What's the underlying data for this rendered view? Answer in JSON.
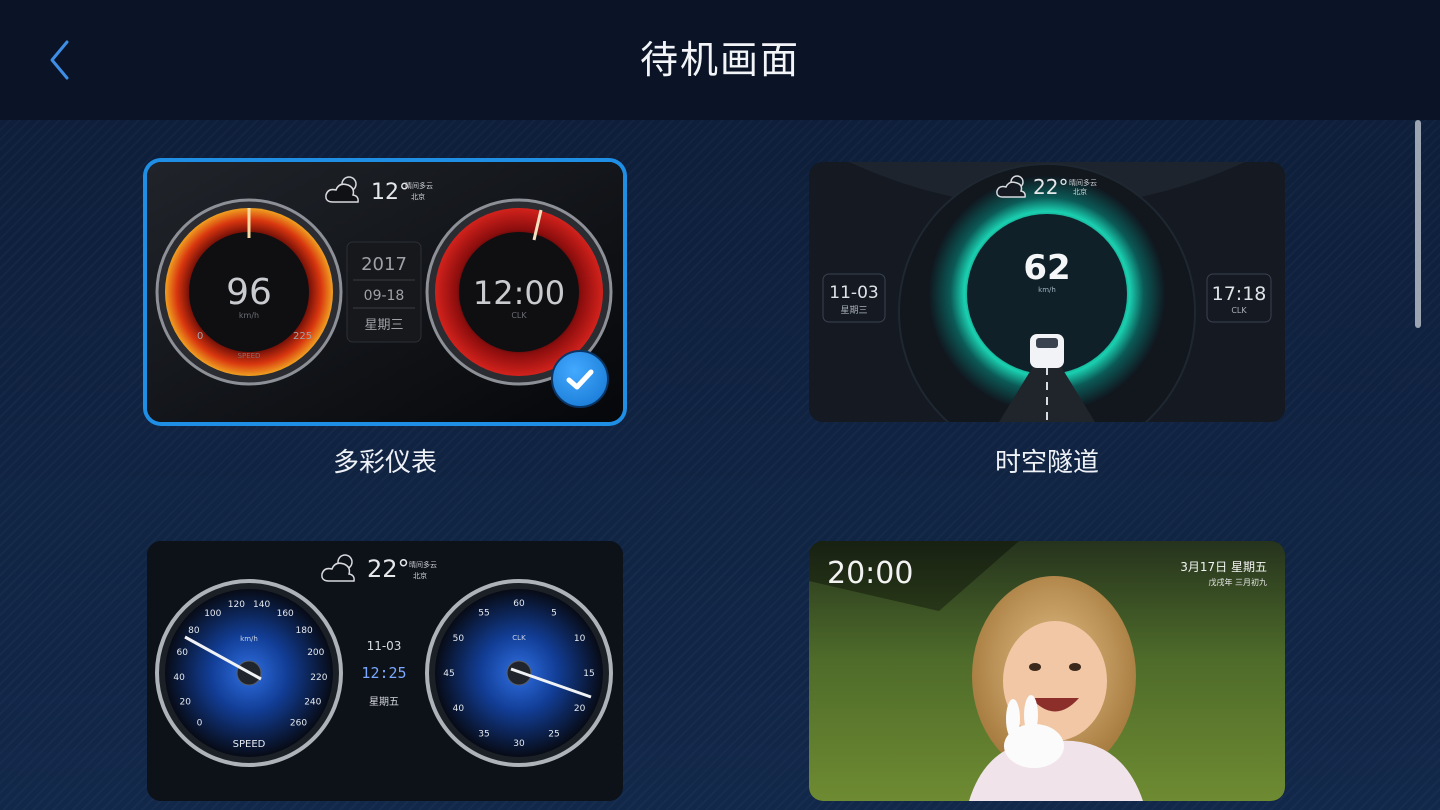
{
  "header": {
    "title": "待机画面",
    "back_icon": "chevron-left-icon"
  },
  "colors": {
    "accent": "#1f8fe6",
    "background": "#0e1f3d",
    "header_bg": "#0a1426"
  },
  "themes": [
    {
      "label": "多彩仪表",
      "selected": true,
      "preview": {
        "temperature": "12°",
        "weather": "晴间多云",
        "city": "北京",
        "speed": "96",
        "speed_unit": "km/h",
        "speed_min": "0",
        "speed_max": "225",
        "speed_label": "SPEED",
        "year": "2017",
        "date": "09-18",
        "weekday": "星期三",
        "time": "12:00",
        "time_label": "CLK"
      }
    },
    {
      "label": "时空隧道",
      "selected": false,
      "preview": {
        "temperature": "22°",
        "weather": "晴间多云",
        "city": "北京",
        "speed": "62",
        "speed_unit": "km/h",
        "date": "11-03",
        "weekday": "星期三",
        "time": "17:18",
        "time_label": "CLK"
      }
    },
    {
      "label": "",
      "selected": false,
      "preview": {
        "temperature": "22°",
        "weather": "晴间多云",
        "city": "北京",
        "date": "11-03",
        "time": "12:25",
        "weekday": "星期五",
        "speed_unit": "km/h",
        "speed_label": "SPEED",
        "speed_ticks": [
          "0",
          "20",
          "40",
          "60",
          "80",
          "100",
          "120",
          "140",
          "160",
          "180",
          "200",
          "220",
          "240",
          "260"
        ],
        "clock_label": "CLK",
        "clock_ticks": [
          "60",
          "5",
          "10",
          "15",
          "20",
          "25",
          "30",
          "35",
          "40",
          "45",
          "50",
          "55"
        ]
      }
    },
    {
      "label": "",
      "selected": false,
      "preview": {
        "time": "20:00",
        "date": "3月17日 星期五",
        "lunar": "戊戌年 三月初九"
      }
    }
  ]
}
